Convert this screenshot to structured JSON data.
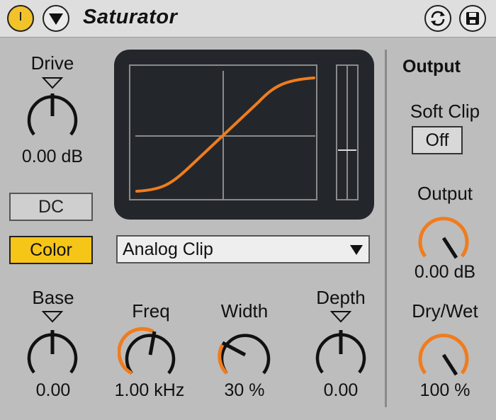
{
  "title_bar": {
    "title": "Saturator",
    "power_color": "#f2c22a"
  },
  "drive": {
    "label": "Drive",
    "value": "0.00 dB"
  },
  "buttons": {
    "dc": "DC",
    "color": "Color",
    "color_active": "#f5c518"
  },
  "display": {
    "curve_color": "#f07c1e",
    "background": "#23272b"
  },
  "type_menu": {
    "selected": "Analog Clip"
  },
  "knobs_bottom": [
    {
      "label": "Base",
      "value": "0.00"
    },
    {
      "label": "Freq",
      "value": "1.00 kHz"
    },
    {
      "label": "Width",
      "value": "30 %"
    },
    {
      "label": "Depth",
      "value": "0.00"
    }
  ],
  "output_section": {
    "title": "Output",
    "soft_clip_label": "Soft Clip",
    "soft_clip_value": "Off",
    "output_label": "Output",
    "output_value": "0.00 dB",
    "drywet_label": "Dry/Wet",
    "drywet_value": "100 %"
  },
  "accent_color": "#f07c1e"
}
